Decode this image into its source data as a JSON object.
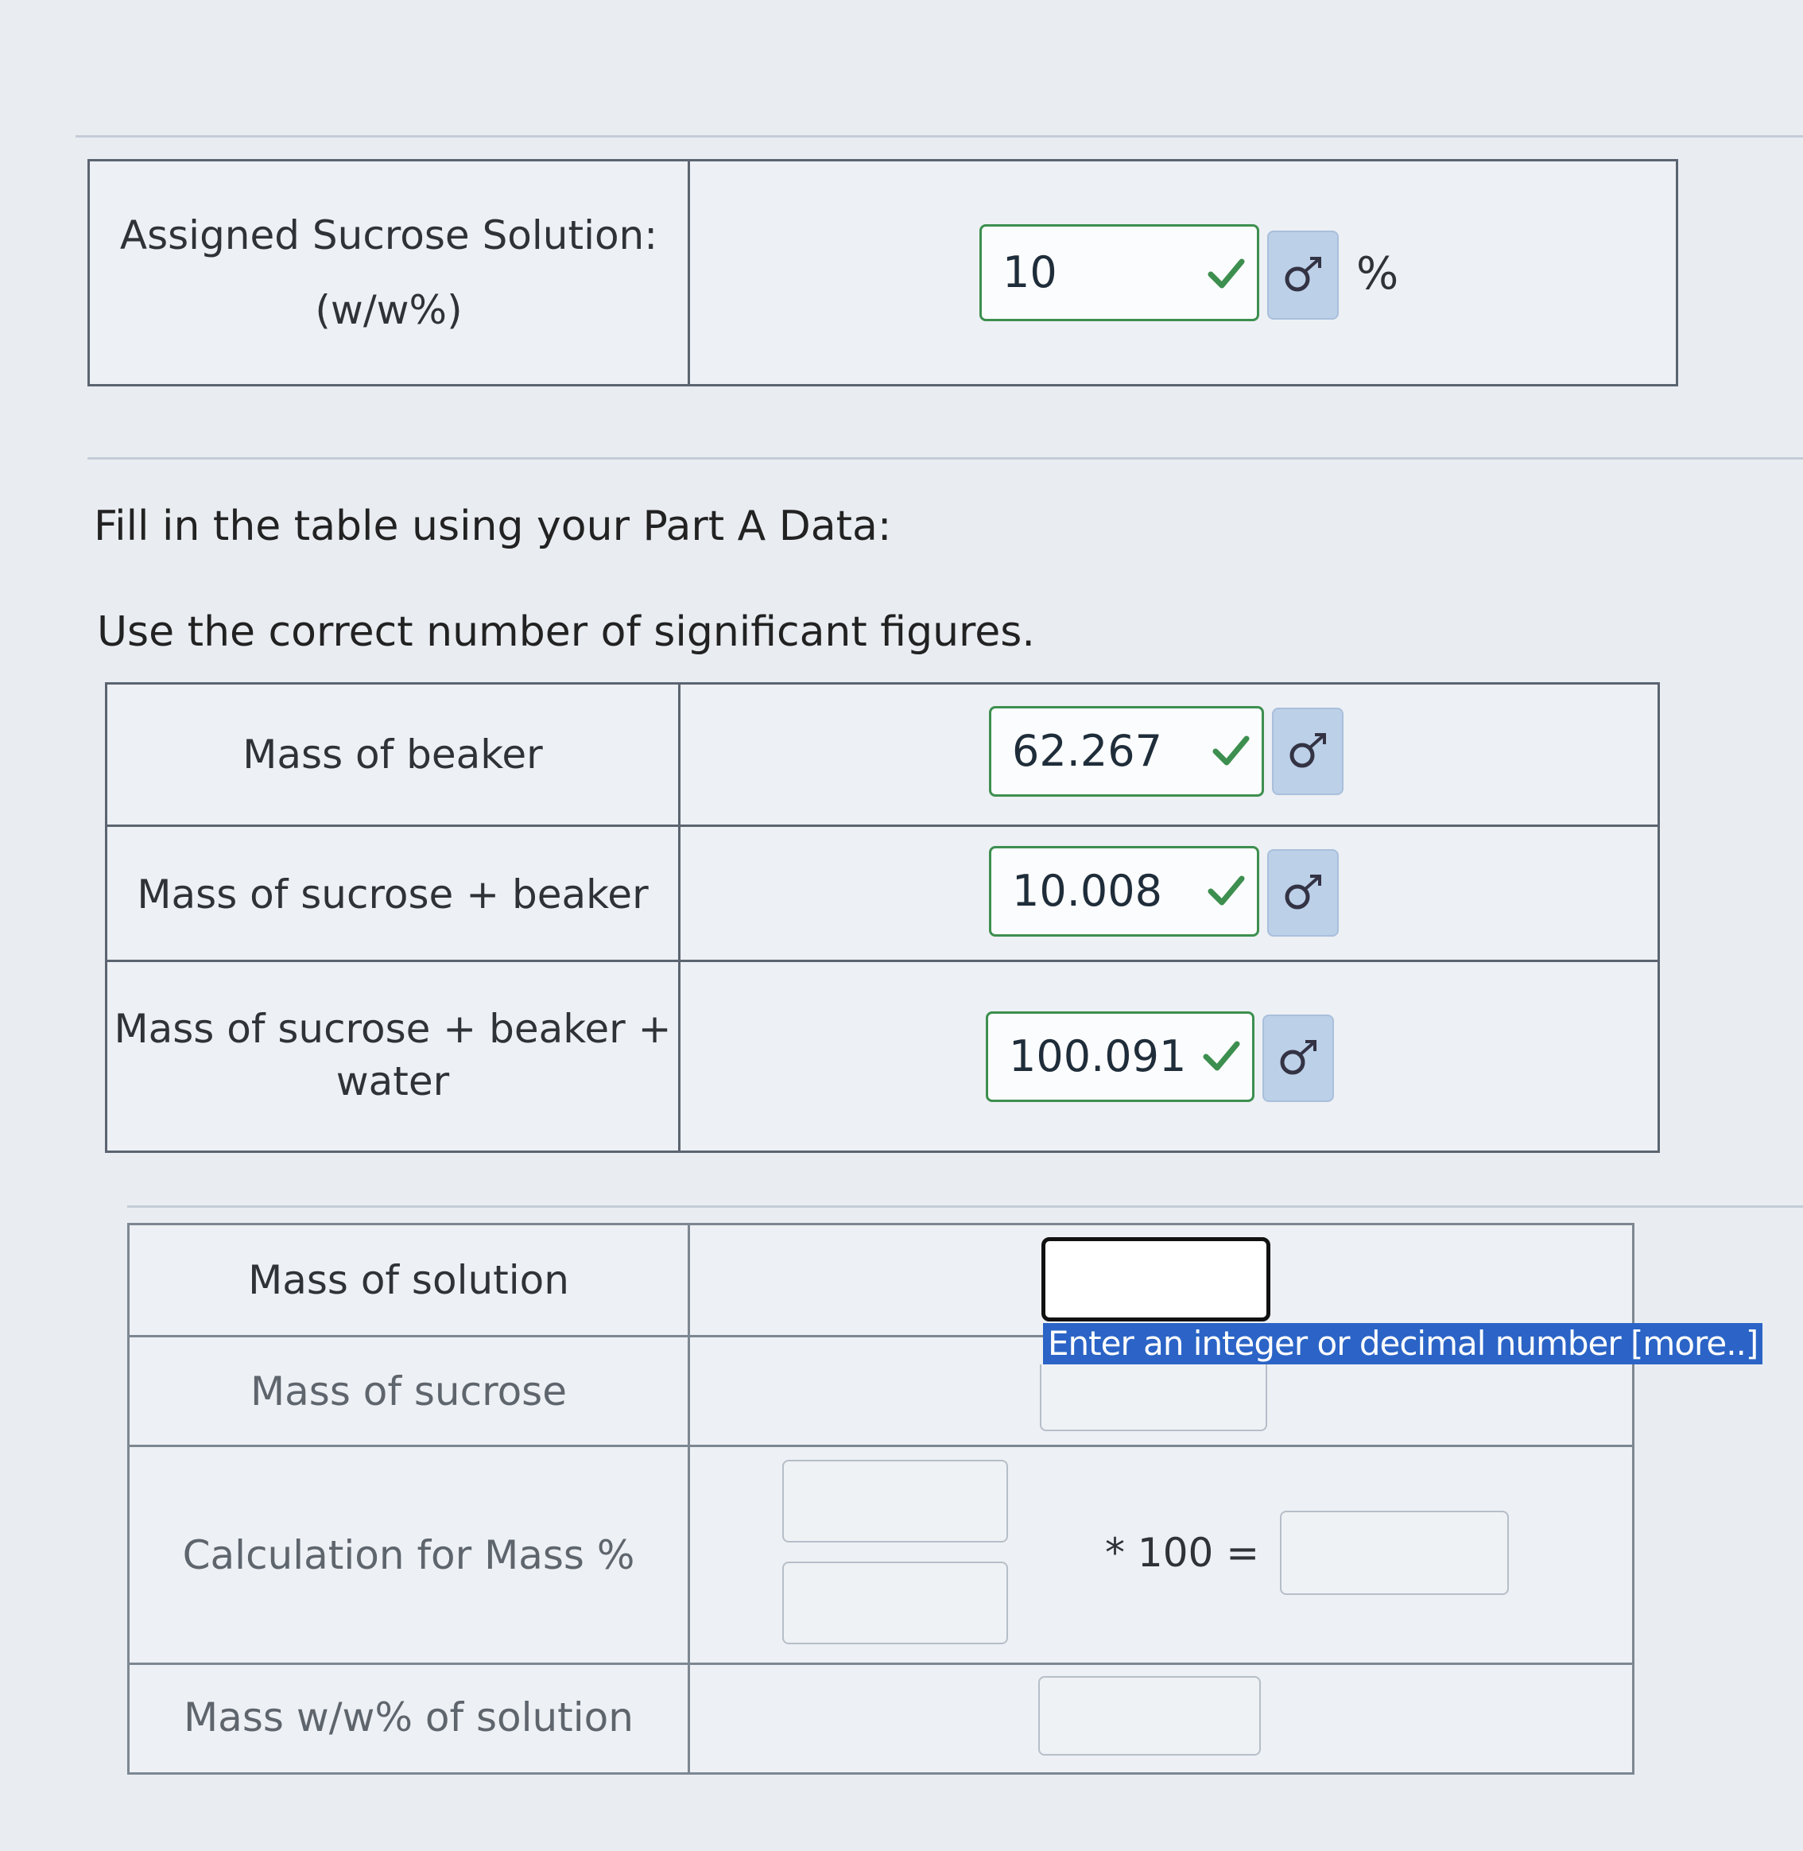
{
  "assigned": {
    "label_line1": "Assigned Sucrose Solution:",
    "label_line2": "(w/w%)",
    "value": "10",
    "unit": "%"
  },
  "instructions": {
    "line1": "Fill in the table using your Part A Data:",
    "line2": "Use the correct number of significant figures."
  },
  "data_table": {
    "rows": [
      {
        "label": "Mass of beaker",
        "value": "62.267"
      },
      {
        "label": "Mass of sucrose + beaker",
        "value": "10.008"
      },
      {
        "label_line1": "Mass of sucrose + beaker +",
        "label_line2": "water",
        "value": "100.091"
      }
    ]
  },
  "calc_table": {
    "mass_solution_label": "Mass of solution",
    "mass_sucrose_label": "Mass of sucrose",
    "calc_label": "Calculation for Mass %",
    "times_text": "* 100 =",
    "ww_label": "Mass w/w% of solution",
    "tooltip_text": "Enter an integer or decimal number ",
    "tooltip_more": "[more..]"
  },
  "colors": {
    "check_green": "#3d8f4f",
    "symbol_button_bg": "#bcd0e8",
    "tooltip_bg": "#2b64c6"
  },
  "icons": {
    "correct": "check-icon",
    "symbol": "sigma-symbol-icon"
  }
}
